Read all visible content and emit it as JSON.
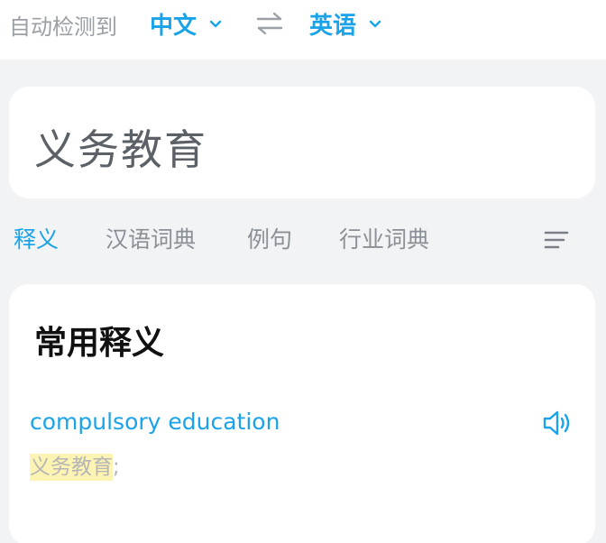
{
  "topbar": {
    "auto_detect_label": "自动检测到",
    "source_lang": "中文",
    "target_lang": "英语"
  },
  "input": {
    "text": "义务教育"
  },
  "tabs": [
    {
      "label": "释义",
      "active": true
    },
    {
      "label": "汉语词典",
      "active": false
    },
    {
      "label": "例句",
      "active": false
    },
    {
      "label": "行业词典",
      "active": false
    }
  ],
  "result": {
    "section_title": "常用释义",
    "definition": {
      "word": "compulsory education",
      "translation": "义务教育",
      "separator": ";"
    }
  },
  "colors": {
    "accent": "#1aa3e8",
    "highlight": "#fdf3b3"
  }
}
